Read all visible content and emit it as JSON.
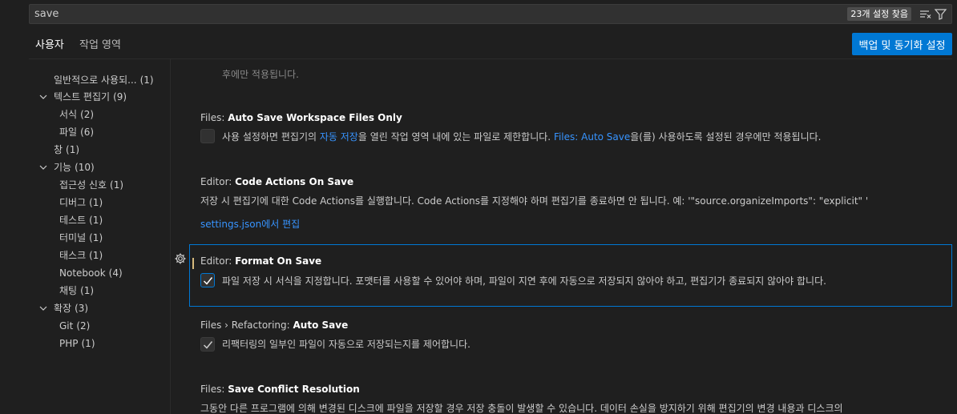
{
  "search": {
    "value": "save",
    "results_badge": "23개 설정 찾음",
    "clear_filter_icon": "clear-filter-icon",
    "filter_icon": "filter-icon"
  },
  "tabs": [
    {
      "label": "사용자",
      "active": true
    },
    {
      "label": "작업 영역",
      "active": false
    }
  ],
  "sync_button": "백업 및 동기화 설정",
  "toc": [
    {
      "label": "일반적으로 사용되...",
      "count": "(1)"
    },
    {
      "label": "텍스트 편집기",
      "count": "(9)",
      "expanded": true
    },
    {
      "label": "서식",
      "count": "(2)"
    },
    {
      "label": "파일",
      "count": "(6)"
    },
    {
      "label": "창",
      "count": "(1)"
    },
    {
      "label": "기능",
      "count": "(10)",
      "expanded": true
    },
    {
      "label": "접근성 신호",
      "count": "(1)"
    },
    {
      "label": "디버그",
      "count": "(1)"
    },
    {
      "label": "테스트",
      "count": "(1)"
    },
    {
      "label": "터미널",
      "count": "(1)"
    },
    {
      "label": "태스크",
      "count": "(1)"
    },
    {
      "label": "Notebook",
      "count": "(4)"
    },
    {
      "label": "채팅",
      "count": "(1)"
    },
    {
      "label": "확장",
      "count": "(3)",
      "expanded": true
    },
    {
      "label": "Git",
      "count": "(2)"
    },
    {
      "label": "PHP",
      "count": "(1)"
    }
  ],
  "settings": {
    "partial_top": "후에만 적용됩니다.",
    "workspace_files": {
      "category": "Files: ",
      "name": "Auto Save Workspace Files Only",
      "desc_pre": "사용 설정하면 편집기의 ",
      "desc_link1": "자동 저장",
      "desc_mid": "을 열린 작업 영역 내에 있는 파일로 제한합니다. ",
      "desc_link2": "Files: Auto Save",
      "desc_post": "을(를) 사용하도록 설정된 경우에만 적용됩니다.",
      "checked": false
    },
    "code_actions": {
      "category": "Editor: ",
      "name": "Code Actions On Save",
      "desc": "저장 시 편집기에 대한 Code Actions를 실행합니다. Code Actions를 지정해야 하며 편집기를 종료하면 안 됩니다. 예: '\"source.organizeImports\": \"explicit\" '",
      "link": "settings.json에서 편집"
    },
    "format_on_save": {
      "category": "Editor: ",
      "name": "Format On Save",
      "desc": "파일 저장 시 서식을 지정합니다. 포맷터를 사용할 수 있어야 하며, 파일이 지연 후에 자동으로 저장되지 않아야 하고, 편집기가 종료되지 않아야 합니다.",
      "checked": true
    },
    "refactoring": {
      "category": "Files › Refactoring: ",
      "name": "Auto Save",
      "desc": "리팩터링의 일부인 파일이 자동으로 저장되는지를 제어합니다.",
      "checked": true
    },
    "conflict": {
      "category": "Files: ",
      "name": "Save Conflict Resolution",
      "desc": "그동안 다른 프로그램에 의해 변경된 디스크에 파일을 저장할 경우 저장 충돌이 발생할 수 있습니다. 데이터 손실을 방지하기 위해 편집기의 변경 내용과 디스크의"
    }
  },
  "colors": {
    "accent": "#0078d4",
    "link": "#3794ff",
    "modified": "#d7ba7d",
    "background": "#1f1f1f"
  }
}
